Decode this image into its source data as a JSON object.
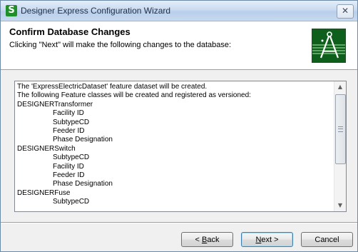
{
  "window": {
    "title": "Designer Express Configuration Wizard",
    "close_glyph": "✕"
  },
  "header": {
    "title": "Confirm Database Changes",
    "subtitle": "Clicking \"Next\" will make the following changes to the database:"
  },
  "changes": {
    "lines": [
      {
        "text": "The 'ExpressElectricDataset' feature dataset will be created.",
        "indent": false
      },
      {
        "text": "The following Feature classes will be created and registered as versioned:",
        "indent": false
      },
      {
        "text": "DESIGNERTransformer",
        "indent": false
      },
      {
        "text": "Facility ID",
        "indent": true
      },
      {
        "text": "SubtypeCD",
        "indent": true
      },
      {
        "text": "Feeder ID",
        "indent": true
      },
      {
        "text": "Phase Designation",
        "indent": true
      },
      {
        "text": "DESIGNERSwitch",
        "indent": false
      },
      {
        "text": "SubtypeCD",
        "indent": true
      },
      {
        "text": "Facility ID",
        "indent": true
      },
      {
        "text": "Feeder ID",
        "indent": true
      },
      {
        "text": "Phase Designation",
        "indent": true
      },
      {
        "text": "DESIGNERFuse",
        "indent": false
      },
      {
        "text": "SubtypeCD",
        "indent": true
      }
    ]
  },
  "scrollbar": {
    "position": 0.0
  },
  "buttons": {
    "back": {
      "pre": "< ",
      "mnemonic": "B",
      "rest": "ack"
    },
    "next": {
      "mnemonic": "N",
      "rest": "ext >"
    },
    "cancel": "Cancel"
  },
  "icons": {
    "app": "designer-express-app-icon",
    "logo": "drafting-compass-logo-icon"
  },
  "colors": {
    "logo_bg": "#0f5f1c",
    "default_button_border": "#3c7fb1"
  }
}
